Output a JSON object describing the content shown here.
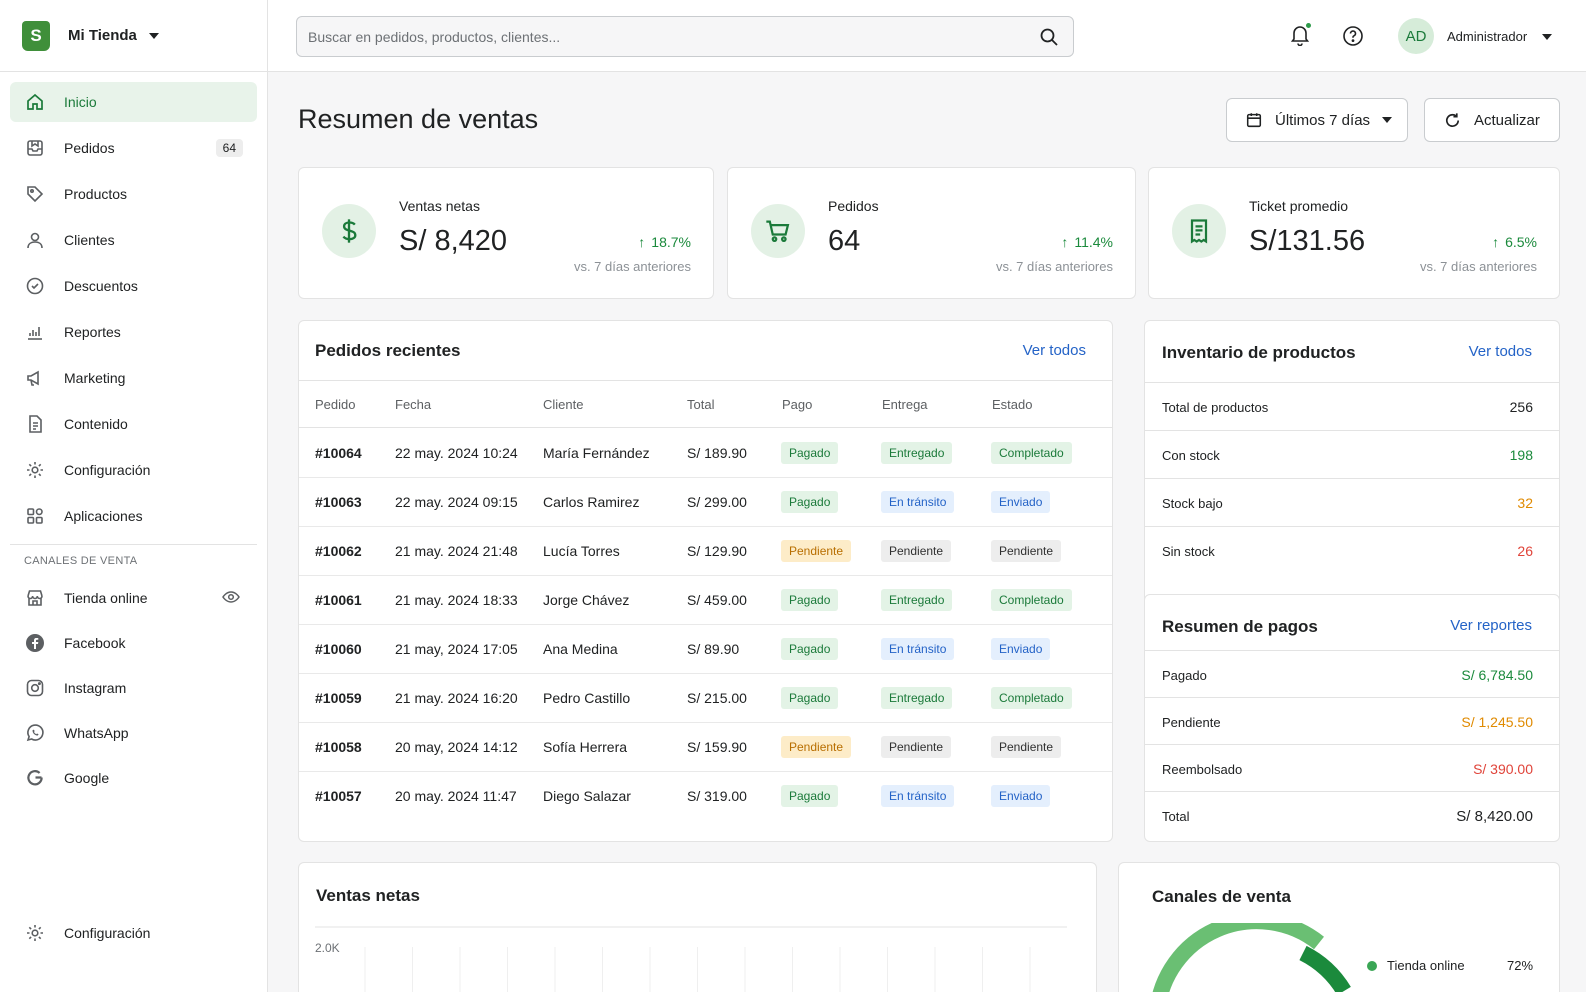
{
  "brand": {
    "store_name": "Mi Tienda",
    "logo_letter": "S"
  },
  "sidebar": {
    "items": [
      {
        "label": "Inicio",
        "icon": "home-icon",
        "active": true
      },
      {
        "label": "Pedidos",
        "icon": "orders-icon",
        "count": "64"
      },
      {
        "label": "Productos",
        "icon": "tag-icon"
      },
      {
        "label": "Clientes",
        "icon": "person-icon"
      },
      {
        "label": "Descuentos",
        "icon": "discount-icon"
      },
      {
        "label": "Reportes",
        "icon": "bar-chart-icon"
      },
      {
        "label": "Marketing",
        "icon": "megaphone-icon"
      },
      {
        "label": "Contenido",
        "icon": "document-icon"
      },
      {
        "label": "Configuración",
        "icon": "gear-icon"
      },
      {
        "label": "Aplicaciones",
        "icon": "apps-icon"
      }
    ],
    "channels_title": "CANALES DE VENTA",
    "channels": [
      {
        "label": "Tienda online",
        "icon": "store-icon"
      },
      {
        "label": "Facebook",
        "icon": "facebook-icon"
      },
      {
        "label": "Instagram",
        "icon": "instagram-icon"
      },
      {
        "label": "WhatsApp",
        "icon": "whatsapp-icon"
      },
      {
        "label": "Google",
        "icon": "google-icon"
      }
    ],
    "bottom_label": "Configuración"
  },
  "topbar": {
    "search_placeholder": "Buscar en pedidos, productos, clientes...",
    "avatar_initials": "AD",
    "user_name": "Administrador"
  },
  "page": {
    "title": "Resumen de ventas",
    "range_label": "Últimos 7 días",
    "refresh_label": "Actualizar"
  },
  "kpis": [
    {
      "label": "Ventas netas",
      "value": "S/ 8,420",
      "delta": "18.7%",
      "sub": "vs. 7 días anteriores",
      "icon": "dollar-icon"
    },
    {
      "label": "Pedidos",
      "value": "64",
      "delta": "11.4%",
      "sub": "vs. 7 días anteriores",
      "icon": "cart-icon"
    },
    {
      "label": "Ticket promedio",
      "value": "S/131.56",
      "delta": "6.5%",
      "sub": "vs. 7 días anteriores",
      "icon": "receipt-icon"
    }
  ],
  "orders": {
    "title": "Pedidos recientes",
    "link": "Ver todos",
    "columns": [
      "Pedido",
      "Fecha",
      "Cliente",
      "Total",
      "Pago",
      "Entrega",
      "Estado"
    ],
    "rows": [
      {
        "id": "#10064",
        "date": "22 may. 2024 10:24",
        "client": "María Fernández",
        "total": "S/ 189.90",
        "pay": "Pagado",
        "ship": "Entregado",
        "status": "Completado"
      },
      {
        "id": "#10063",
        "date": "22 may. 2024 09:15",
        "client": "Carlos Ramirez",
        "total": "S/ 299.00",
        "pay": "Pagado",
        "ship": "En tránsito",
        "status": "Enviado"
      },
      {
        "id": "#10062",
        "date": "21 may. 2024 21:48",
        "client": "Lucía Torres",
        "total": "S/ 129.90",
        "pay": "Pendiente",
        "ship": "Pendiente",
        "status": "Pendiente"
      },
      {
        "id": "#10061",
        "date": "21 may. 2024 18:33",
        "client": "Jorge Chávez",
        "total": "S/ 459.00",
        "pay": "Pagado",
        "ship": "Entregado",
        "status": "Completado"
      },
      {
        "id": "#10060",
        "date": "21 may, 2024 17:05",
        "client": "Ana Medina",
        "total": "S/ 89.90",
        "pay": "Pagado",
        "ship": "En tránsito",
        "status": "Enviado"
      },
      {
        "id": "#10059",
        "date": "21 may. 2024 16:20",
        "client": "Pedro Castillo",
        "total": "S/ 215.00",
        "pay": "Pagado",
        "ship": "Entregado",
        "status": "Completado"
      },
      {
        "id": "#10058",
        "date": "20 may, 2024 14:12",
        "client": "Sofía Herrera",
        "total": "S/ 159.90",
        "pay": "Pendiente",
        "ship": "Pendiente",
        "status": "Pendiente"
      },
      {
        "id": "#10057",
        "date": "20 may. 2024 11:47",
        "client": "Diego Salazar",
        "total": "S/ 319.00",
        "pay": "Pagado",
        "ship": "En tránsito",
        "status": "Enviado"
      }
    ]
  },
  "inventory": {
    "title": "Inventario de productos",
    "link": "Ver todos",
    "rows": [
      {
        "label": "Total de productos",
        "value": "256",
        "color": "#202223"
      },
      {
        "label": "Con stock",
        "value": "198",
        "color": "#1b8a3c"
      },
      {
        "label": "Stock bajo",
        "value": "32",
        "color": "#e08a00"
      },
      {
        "label": "Sin stock",
        "value": "26",
        "color": "#e0443a"
      }
    ]
  },
  "payments": {
    "title": "Resumen de pagos",
    "link": "Ver reportes",
    "rows": [
      {
        "label": "Pagado",
        "value": "S/ 6,784.50",
        "color": "#1b8a3c"
      },
      {
        "label": "Pendiente",
        "value": "S/ 1,245.50",
        "color": "#e08a00"
      },
      {
        "label": "Reembolsado",
        "value": "S/ 390.00",
        "color": "#e0443a"
      },
      {
        "label": "Total",
        "value": "S/ 8,420.00",
        "color": "#202223"
      }
    ]
  },
  "sales_chart": {
    "title": "Ventas netas",
    "y_tick": "2.0K"
  },
  "channels_chart": {
    "title": "Canales de venta",
    "legend": [
      {
        "label": "Tienda online",
        "pct": "72%",
        "color": "#3aa655"
      }
    ]
  },
  "colors": {
    "accent": "#1b7a3a",
    "link": "#2463c7"
  }
}
